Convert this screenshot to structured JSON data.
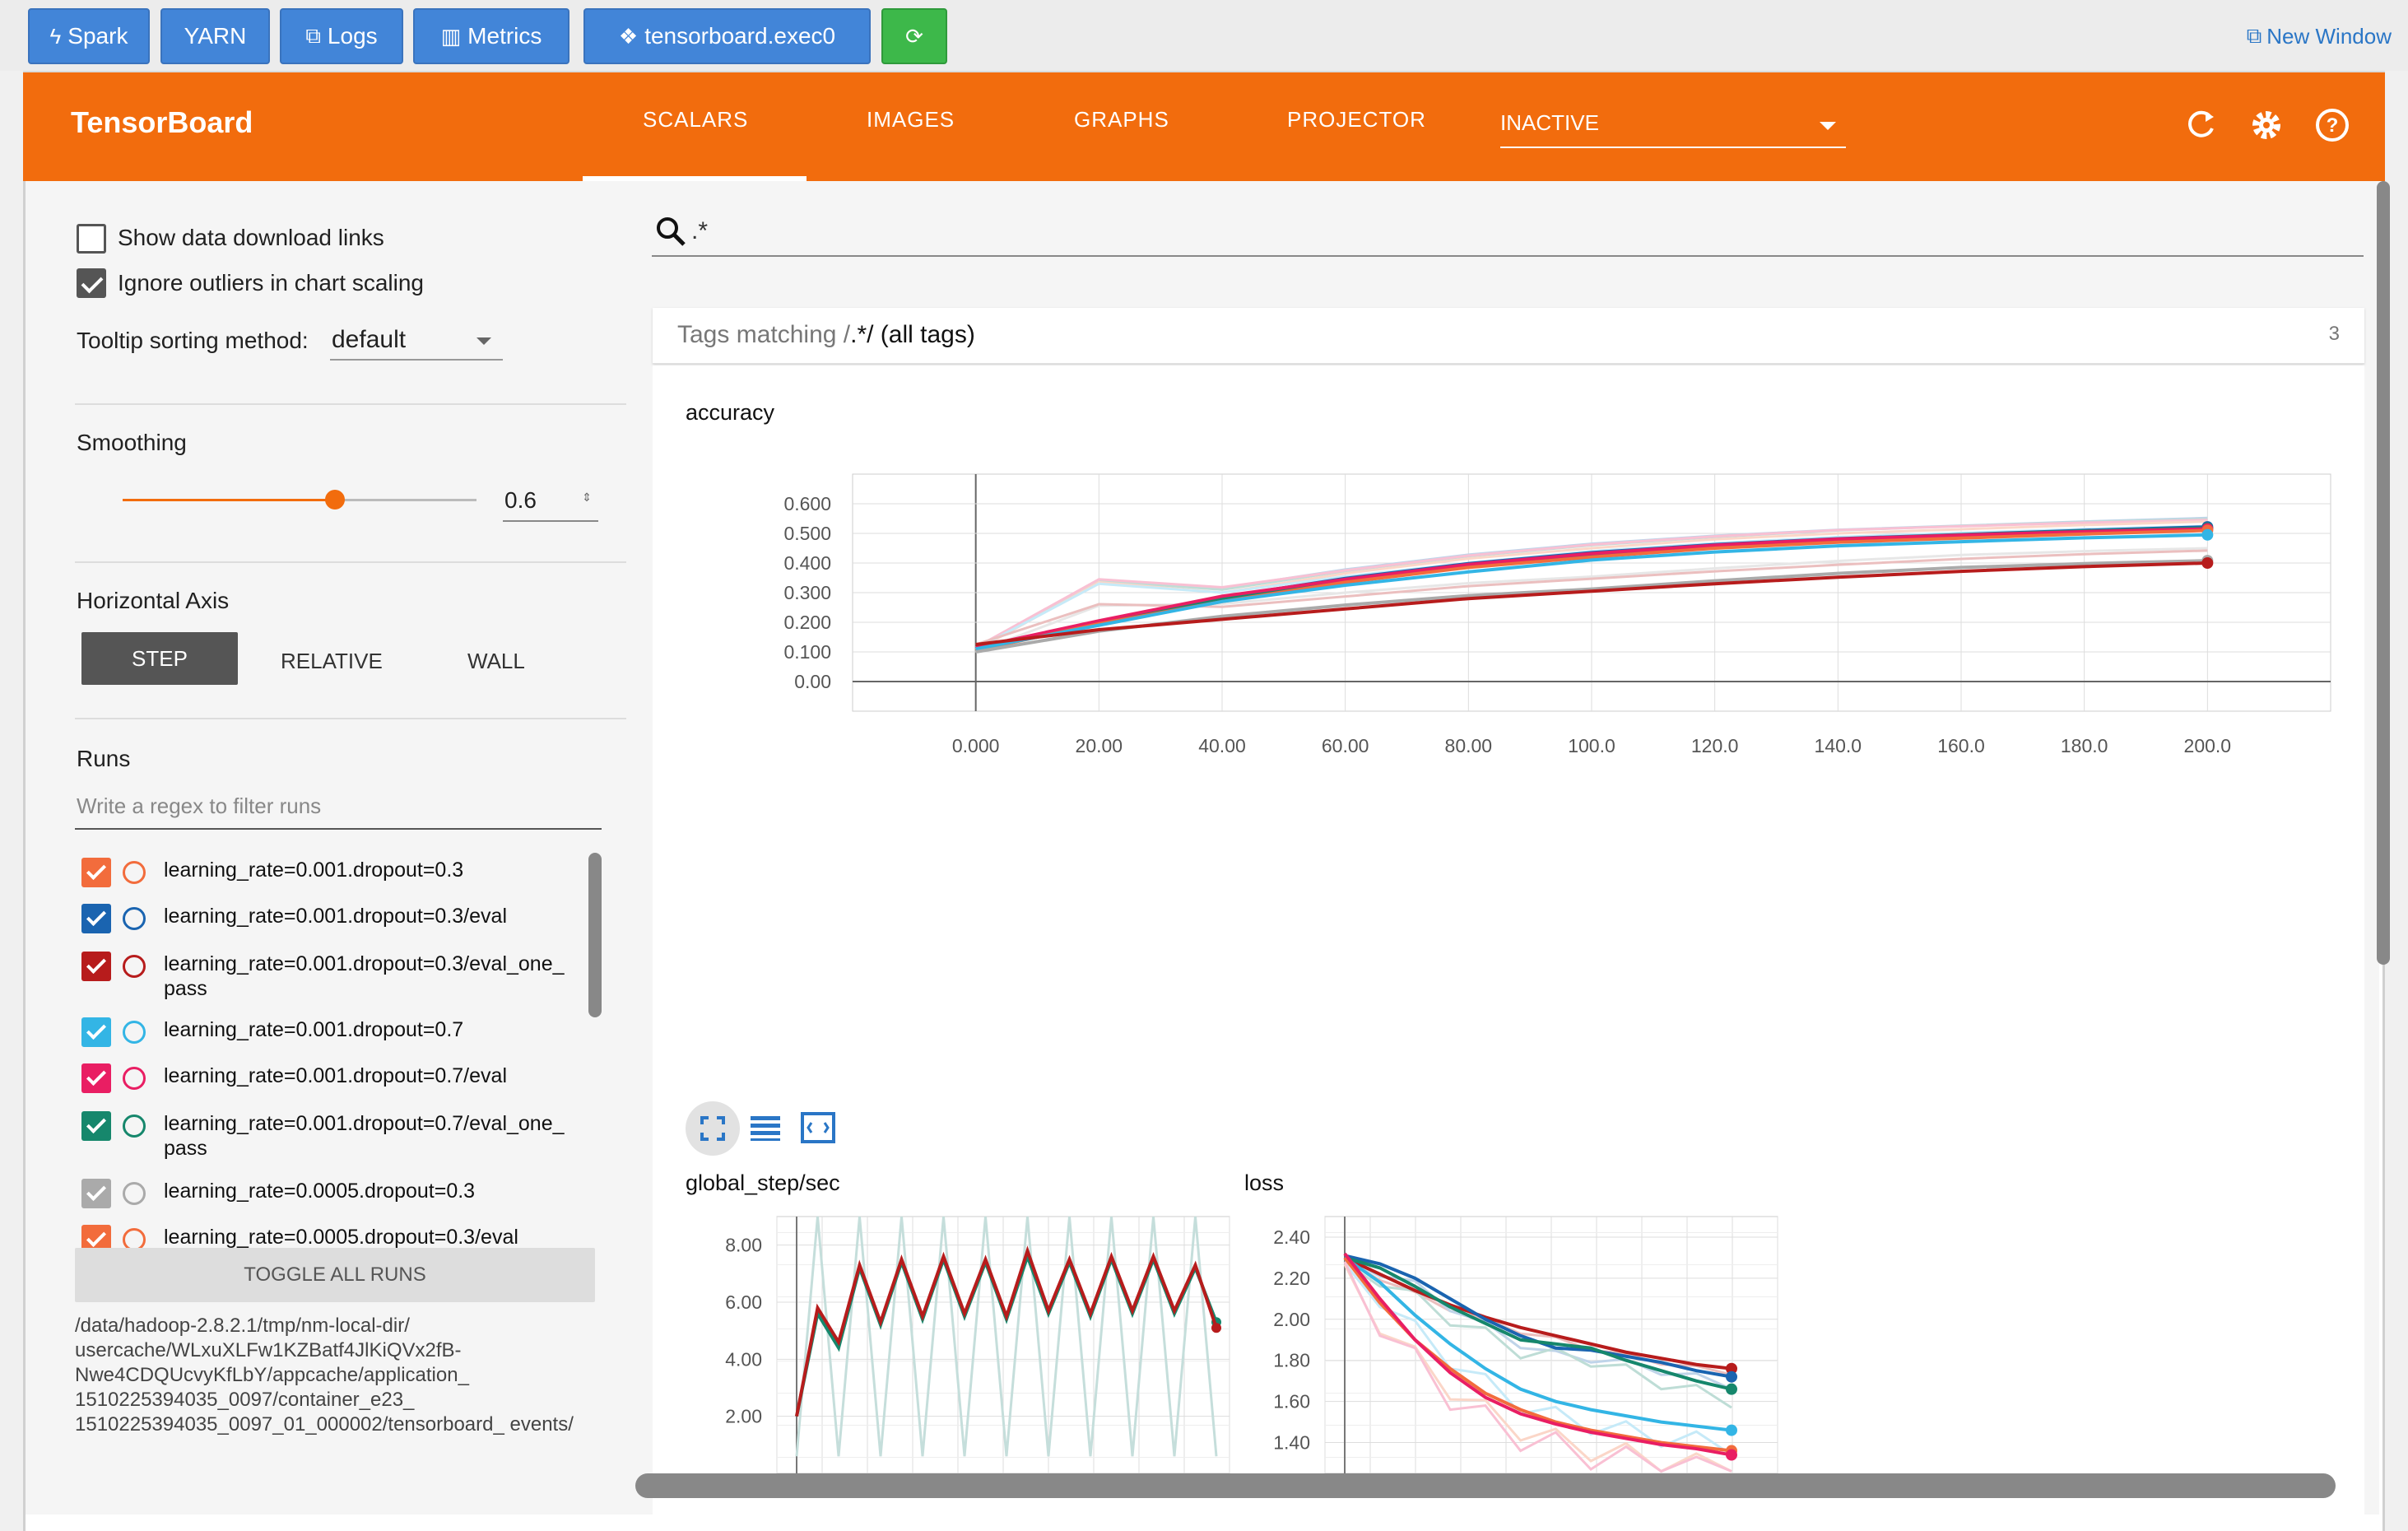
{
  "toolbar": {
    "spark": "Spark",
    "yarn": "YARN",
    "logs": "Logs",
    "metrics": "Metrics",
    "exec": "tensorboard.exec0",
    "new_window": "New Window"
  },
  "app": {
    "title": "TensorBoard",
    "tabs": [
      "SCALARS",
      "IMAGES",
      "GRAPHS",
      "PROJECTOR"
    ],
    "active_tab": "SCALARS",
    "inactive_select": "INACTIVE"
  },
  "sidebar": {
    "show_download": "Show data download links",
    "ignore_outliers": "Ignore outliers in chart scaling",
    "tooltip_label": "Tooltip sorting method:",
    "tooltip_value": "default",
    "smoothing_label": "Smoothing",
    "smoothing_value": "0.6",
    "smoothing_fraction": 0.6,
    "haxis_label": "Horizontal Axis",
    "haxis_options": [
      "STEP",
      "RELATIVE",
      "WALL"
    ],
    "runs_label": "Runs",
    "runs_filter_placeholder": "Write a regex to filter runs",
    "runs": [
      {
        "label": "learning_rate=0.001.dropout=0.3",
        "color": "#f26c3c"
      },
      {
        "label": "learning_rate=0.001.dropout=0.3/eval",
        "color": "#1a64b0"
      },
      {
        "label": "learning_rate=0.001.dropout=0.3/eval_one_ pass",
        "color": "#b71c1c"
      },
      {
        "label": "learning_rate=0.001.dropout=0.7",
        "color": "#33b5e5"
      },
      {
        "label": "learning_rate=0.001.dropout=0.7/eval",
        "color": "#e91e63"
      },
      {
        "label": "learning_rate=0.001.dropout=0.7/eval_one_ pass",
        "color": "#16876c"
      },
      {
        "label": "learning_rate=0.0005.dropout=0.3",
        "color": "#aaaaaa"
      },
      {
        "label": "learning_rate=0.0005.dropout=0.3/eval",
        "color": "#f26c3c"
      }
    ],
    "toggle_all": "TOGGLE ALL RUNS",
    "logdir": "/data/hadoop-2.8.2.1/tmp/nm-local-dir/ usercache/WLxuXLFw1KZBatf4JlKiQVx2fB- Nwe4CDQUcvyKfLbY/appcache/application_ 1510225394035_0097/container_e23_ 1510225394035_0097_01_000002/tensorboard_ events/"
  },
  "main": {
    "search_value": ".*",
    "tags_prefix": "Tags matching /",
    "tags_regex": ".*",
    "tags_suffix": "/ (all tags)",
    "tags_count": "3"
  },
  "chart_data": [
    {
      "type": "line",
      "title": "accuracy",
      "x_ticks": [
        "0.000",
        "20.00",
        "40.00",
        "60.00",
        "80.00",
        "100.0",
        "120.0",
        "140.0",
        "160.0",
        "180.0",
        "200.0"
      ],
      "y_ticks": [
        "0.00",
        "0.100",
        "0.200",
        "0.300",
        "0.400",
        "0.500",
        "0.600"
      ],
      "xlim": [
        -20,
        220
      ],
      "ylim": [
        -0.1,
        0.7
      ],
      "grid": true,
      "series": [
        {
          "color": "#1a64b0",
          "x": [
            0,
            20,
            40,
            60,
            80,
            100,
            120,
            140,
            160,
            180,
            200
          ],
          "y": [
            0.11,
            0.2,
            0.285,
            0.348,
            0.398,
            0.435,
            0.462,
            0.482,
            0.496,
            0.51,
            0.522
          ]
        },
        {
          "color": "#16876c",
          "x": [
            0,
            20,
            40,
            60,
            80,
            100,
            120,
            140,
            160,
            180,
            200
          ],
          "y": [
            0.11,
            0.2,
            0.28,
            0.343,
            0.393,
            0.43,
            0.458,
            0.48,
            0.495,
            0.508,
            0.518
          ]
        },
        {
          "color": "#e91e63",
          "x": [
            0,
            20,
            40,
            60,
            80,
            100,
            120,
            140,
            160,
            180,
            200
          ],
          "y": [
            0.115,
            0.205,
            0.288,
            0.345,
            0.395,
            0.432,
            0.46,
            0.481,
            0.494,
            0.506,
            0.515
          ]
        },
        {
          "color": "#f26c3c",
          "x": [
            0,
            20,
            40,
            60,
            80,
            100,
            120,
            140,
            160,
            180,
            200
          ],
          "y": [
            0.105,
            0.195,
            0.27,
            0.335,
            0.385,
            0.42,
            0.45,
            0.47,
            0.484,
            0.498,
            0.51
          ]
        },
        {
          "color": "#33b5e5",
          "x": [
            0,
            20,
            40,
            60,
            80,
            100,
            120,
            140,
            160,
            180,
            200
          ],
          "y": [
            0.11,
            0.19,
            0.27,
            0.325,
            0.37,
            0.41,
            0.437,
            0.458,
            0.472,
            0.485,
            0.495
          ]
        },
        {
          "color": "#aaaaaa",
          "x": [
            0,
            20,
            40,
            60,
            80,
            100,
            120,
            140,
            160,
            180,
            200
          ],
          "y": [
            0.1,
            0.17,
            0.22,
            0.258,
            0.29,
            0.312,
            0.34,
            0.365,
            0.385,
            0.398,
            0.408
          ]
        },
        {
          "color": "#b71c1c",
          "x": [
            0,
            20,
            40,
            60,
            80,
            100,
            120,
            140,
            160,
            180,
            200
          ],
          "y": [
            0.125,
            0.175,
            0.21,
            0.245,
            0.28,
            0.305,
            0.33,
            0.352,
            0.372,
            0.388,
            0.4
          ]
        }
      ]
    },
    {
      "type": "line",
      "title": "global_step/sec",
      "y_ticks": [
        "2.00",
        "4.00",
        "6.00",
        "8.00"
      ],
      "ylim": [
        0,
        9
      ],
      "grid": true,
      "series": [
        {
          "color": "#16876c",
          "y": [
            2.0,
            5.6,
            4.4,
            7.2,
            5.2,
            7.4,
            5.4,
            7.5,
            5.5,
            7.4,
            5.4,
            7.6,
            5.6,
            7.4,
            5.5,
            7.5,
            5.6,
            7.5,
            5.6,
            7.2,
            5.3
          ]
        },
        {
          "color": "#b71c1c",
          "y": [
            2.0,
            5.8,
            4.6,
            7.3,
            5.3,
            7.5,
            5.5,
            7.6,
            5.6,
            7.5,
            5.5,
            7.8,
            5.7,
            7.5,
            5.6,
            7.6,
            5.7,
            7.6,
            5.7,
            7.3,
            5.1
          ]
        }
      ]
    },
    {
      "type": "line",
      "title": "loss",
      "y_ticks": [
        "1.40",
        "1.60",
        "1.80",
        "2.00",
        "2.20",
        "2.40"
      ],
      "ylim": [
        1.25,
        2.5
      ],
      "grid": true,
      "series": [
        {
          "color": "#b71c1c",
          "y": [
            2.3,
            2.22,
            2.14,
            2.07,
            2.01,
            1.96,
            1.92,
            1.88,
            1.84,
            1.81,
            1.78,
            1.76
          ]
        },
        {
          "color": "#1a64b0",
          "y": [
            2.31,
            2.27,
            2.2,
            2.1,
            2.0,
            1.92,
            1.86,
            1.85,
            1.82,
            1.79,
            1.75,
            1.72
          ]
        },
        {
          "color": "#16876c",
          "y": [
            2.3,
            2.25,
            2.16,
            2.06,
            1.98,
            1.9,
            1.88,
            1.86,
            1.8,
            1.75,
            1.7,
            1.66
          ]
        },
        {
          "color": "#33b5e5",
          "y": [
            2.3,
            2.18,
            2.02,
            1.88,
            1.76,
            1.66,
            1.6,
            1.56,
            1.53,
            1.5,
            1.48,
            1.46
          ]
        },
        {
          "color": "#f26c3c",
          "y": [
            2.3,
            2.08,
            1.9,
            1.76,
            1.64,
            1.56,
            1.5,
            1.46,
            1.43,
            1.4,
            1.38,
            1.36
          ]
        },
        {
          "color": "#e91e63",
          "y": [
            2.32,
            2.1,
            1.9,
            1.74,
            1.62,
            1.54,
            1.49,
            1.45,
            1.42,
            1.39,
            1.37,
            1.34
          ]
        }
      ]
    }
  ]
}
